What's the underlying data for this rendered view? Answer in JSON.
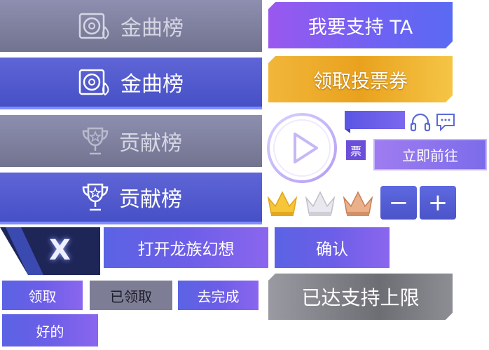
{
  "rank_tabs": {
    "gold_inactive": "金曲榜",
    "gold_active": "金曲榜",
    "contrib_inactive": "贡献榜",
    "contrib_active": "贡献榜"
  },
  "buttons": {
    "support": "我要支持 TA",
    "claim_ticket": "领取投票券",
    "ticket_badge": "票",
    "go_now": "立即前往",
    "open_game": "打开龙族幻想",
    "confirm": "确认",
    "claim": "领取",
    "claimed": "已领取",
    "do_task": "去完成",
    "ok": "好的",
    "limit_reached": "已达支持上限",
    "minus": "−",
    "plus": "+",
    "close_x": "X"
  },
  "colors": {
    "accent_blue": "#4f57d0",
    "accent_purple": "#8a5df0",
    "gold": "#f0b435",
    "gray": "#7a7b93"
  },
  "icons": [
    "record-disc-icon",
    "trophy-icon",
    "headphones-icon",
    "chat-bubble-icon",
    "play-icon",
    "crown-gold-icon",
    "crown-silver-icon",
    "crown-bronze-icon"
  ]
}
